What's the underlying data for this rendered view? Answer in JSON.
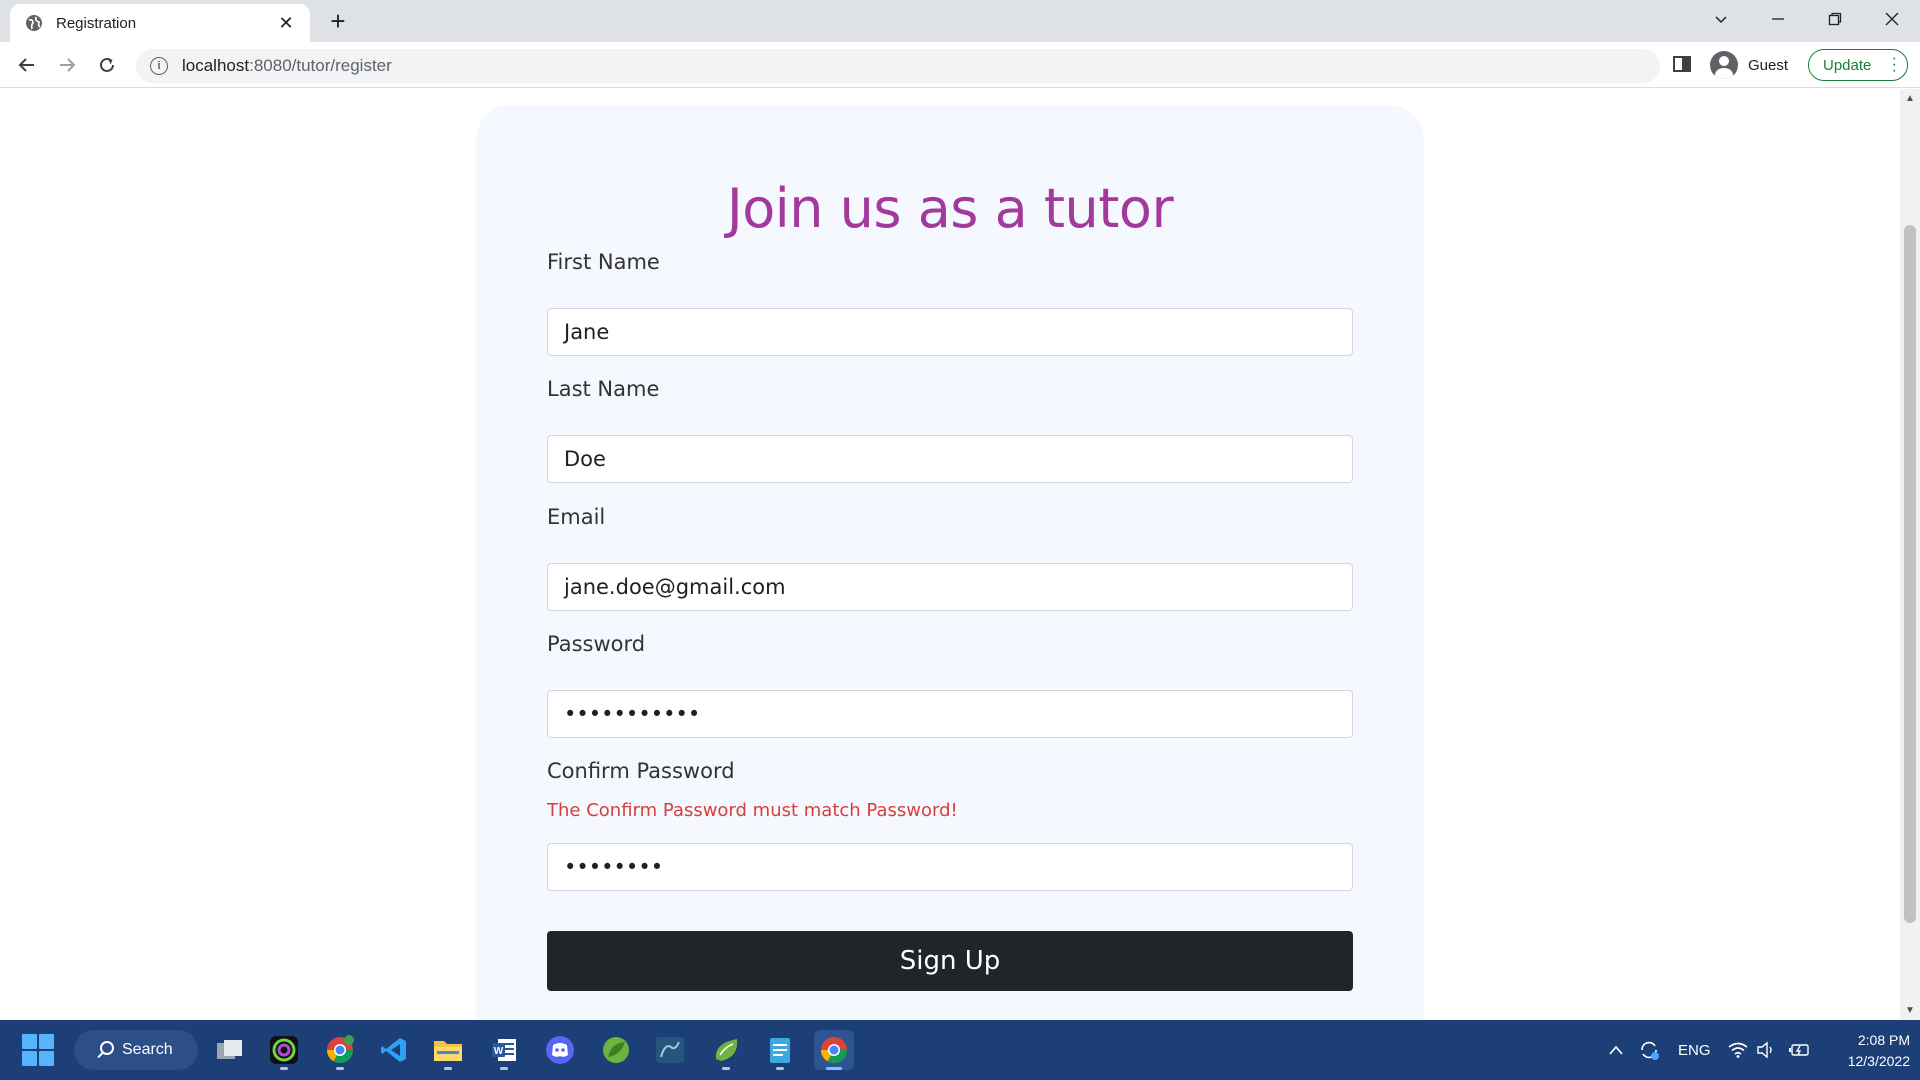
{
  "browser": {
    "tab_title": "Registration",
    "tab_close": "✕",
    "new_tab": "+",
    "url_host": "localhost",
    "url_path": ":8080/tutor/register",
    "profile_name": "Guest",
    "update_label": "Update"
  },
  "form": {
    "heading": "Join us as a tutor",
    "first_name_label": "First Name",
    "first_name_value": "Jane",
    "last_name_label": "Last Name",
    "last_name_value": "Doe",
    "email_label": "Email",
    "email_value": "jane.doe@gmail.com",
    "password_label": "Password",
    "password_value": "•••••••••••",
    "confirm_label": "Confirm Password",
    "confirm_error": "The Confirm Password must match Password!",
    "confirm_value": "••••••••",
    "submit_label": "Sign Up"
  },
  "taskbar": {
    "search_label": "Search",
    "lang": "ENG",
    "time": "2:08 PM",
    "date": "12/3/2022",
    "apps": [
      "task-view",
      "obs",
      "chrome-beta",
      "vscode",
      "file-explorer",
      "word",
      "discord",
      "spring-tool",
      "mysql-workbench",
      "spring-boot",
      "notepad",
      "chrome"
    ]
  },
  "colors": {
    "heading": "#a23a9b",
    "error": "#d6403a",
    "button": "#212529",
    "card": "#f5f8ff",
    "taskbar": "#1c3f77"
  }
}
